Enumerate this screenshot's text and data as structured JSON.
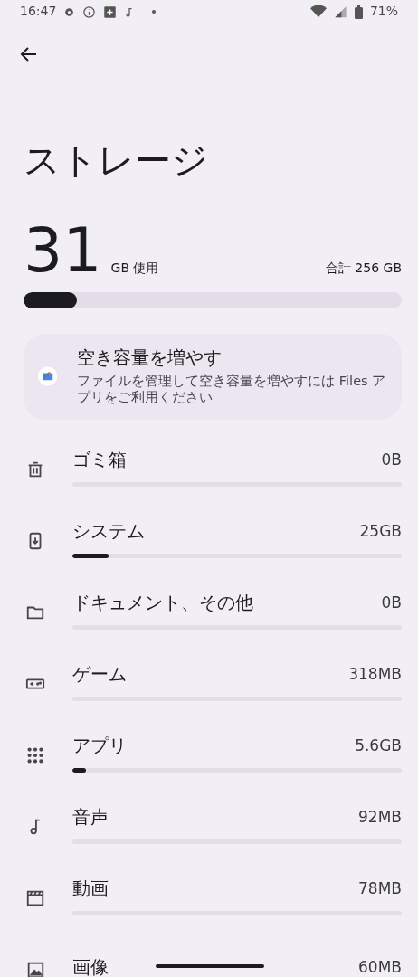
{
  "status_bar": {
    "time": "16:47",
    "battery": "71%"
  },
  "title": "ストレージ",
  "usage": {
    "used": "31",
    "used_unit": "GB 使用",
    "total": "合計 256 GB",
    "level": 0.14
  },
  "card": {
    "title": "空き容量を増やす",
    "text": "ファイルを管理して空き容量を増やすには Files アプリをご利用ください"
  },
  "categories": [
    {
      "kind": "trash",
      "name": "ゴミ箱",
      "size": "0B",
      "level": 0
    },
    {
      "kind": "system",
      "name": "システム",
      "size": "25GB",
      "level": 0.11
    },
    {
      "kind": "documents",
      "name": "ドキュメント、その他",
      "size": "0B",
      "level": 0
    },
    {
      "kind": "games",
      "name": "ゲーム",
      "size": "318MB",
      "level": 0
    },
    {
      "kind": "apps",
      "name": "アプリ",
      "size": "5.6GB",
      "level": 0.04
    },
    {
      "kind": "audio",
      "name": "音声",
      "size": "92MB",
      "level": 0
    },
    {
      "kind": "video",
      "name": "動画",
      "size": "78MB",
      "level": 0
    },
    {
      "kind": "images",
      "name": "画像",
      "size": "60MB"
    }
  ]
}
